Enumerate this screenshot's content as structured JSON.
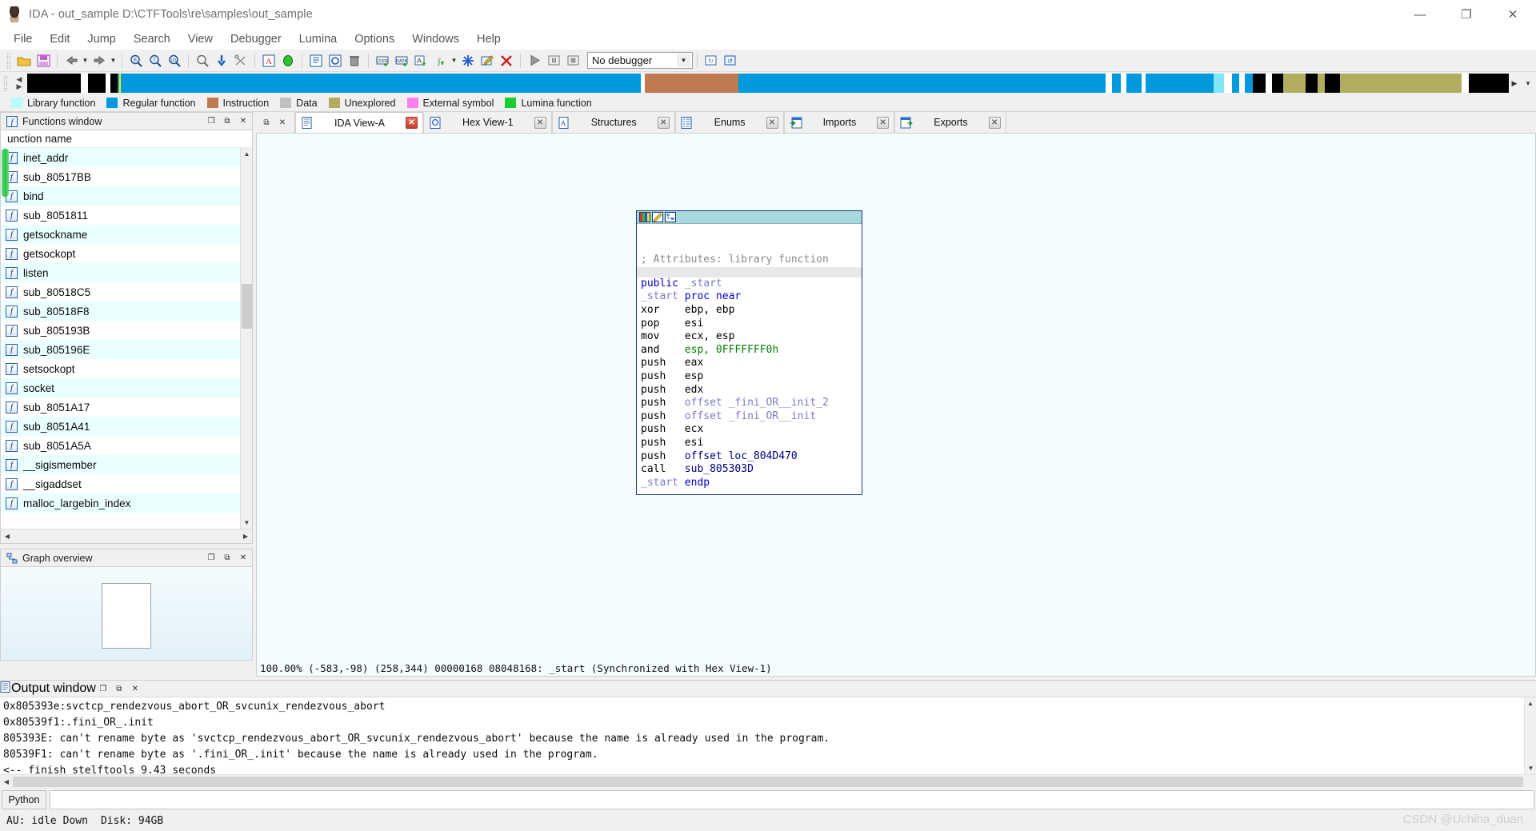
{
  "window": {
    "title": "IDA - out_sample D:\\CTFTools\\re\\samples\\out_sample",
    "app_icon": "ida-logo-icon",
    "minimize": "—",
    "maximize": "❐",
    "close": "✕"
  },
  "menu": {
    "items": [
      {
        "label": "File"
      },
      {
        "label": "Edit"
      },
      {
        "label": "Jump"
      },
      {
        "label": "Search"
      },
      {
        "label": "View"
      },
      {
        "label": "Debugger"
      },
      {
        "label": "Lumina"
      },
      {
        "label": "Options"
      },
      {
        "label": "Windows"
      },
      {
        "label": "Help"
      }
    ]
  },
  "toolbar": {
    "debugger_select_value": "No debugger",
    "buttons": [
      {
        "name": "open-file-icon",
        "glyph": "📂"
      },
      {
        "name": "save-file-icon",
        "glyph": "💾"
      },
      {
        "name": "back-icon",
        "glyph": "⇦"
      },
      {
        "name": "forward-icon",
        "glyph": "⇨"
      },
      {
        "name": "search-hex-icon",
        "glyph": "🔍"
      },
      {
        "name": "search-text-icon",
        "glyph": "🔍"
      },
      {
        "name": "search-imm-icon",
        "glyph": "🔍"
      },
      {
        "name": "search-next-icon",
        "glyph": "🔎"
      },
      {
        "name": "jump-down-icon",
        "glyph": "⬇"
      },
      {
        "name": "cross-ref-icon",
        "glyph": "✂"
      },
      {
        "name": "ida-view-icon",
        "glyph": "A"
      },
      {
        "name": "graph-view-icon",
        "glyph": "⬭"
      },
      {
        "name": "hex-view-icon",
        "glyph": "▤"
      },
      {
        "name": "structures-icon",
        "glyph": "▣"
      },
      {
        "name": "delete-icon",
        "glyph": "🗑"
      },
      {
        "name": "code-icon",
        "glyph": "⌨"
      },
      {
        "name": "data-icon",
        "glyph": "▦"
      },
      {
        "name": "ascii-icon",
        "glyph": "Ⓐ"
      },
      {
        "name": "struct-var-icon",
        "glyph": "ʃ"
      },
      {
        "name": "struct-dropdown-icon",
        "glyph": "▾"
      },
      {
        "name": "undefine-icon",
        "glyph": "✳"
      },
      {
        "name": "edit-function-icon",
        "glyph": "✎"
      },
      {
        "name": "delete-function-icon",
        "glyph": "✕"
      },
      {
        "name": "run-icon",
        "glyph": "▶"
      },
      {
        "name": "pause-icon",
        "glyph": "▐▌"
      },
      {
        "name": "stop-icon",
        "glyph": "■"
      }
    ],
    "right_buttons": [
      {
        "name": "lumina-pull-icon",
        "glyph": "⬇"
      },
      {
        "name": "lumina-push-icon",
        "glyph": "⬆"
      },
      {
        "name": "options-icon",
        "glyph": "⚙"
      },
      {
        "name": "plugin-a-icon",
        "glyph": "▧"
      },
      {
        "name": "plugin-b-icon",
        "glyph": "▨"
      },
      {
        "name": "plugin-c-icon",
        "glyph": "✄"
      }
    ]
  },
  "navigator": {
    "cursor_left_pct": 6.2,
    "segments": [
      {
        "color": "#000000",
        "start_pct": 0.0,
        "width_pct": 3.6
      },
      {
        "color": "#ffffff",
        "start_pct": 3.6,
        "width_pct": 0.5
      },
      {
        "color": "#000000",
        "start_pct": 4.1,
        "width_pct": 1.2
      },
      {
        "color": "#ffffff",
        "start_pct": 5.3,
        "width_pct": 0.3
      },
      {
        "color": "#000000",
        "start_pct": 5.6,
        "width_pct": 0.5
      },
      {
        "color": "#0099dd",
        "start_pct": 6.1,
        "width_pct": 35.3
      },
      {
        "color": "#ffffff",
        "start_pct": 41.4,
        "width_pct": 0.3
      },
      {
        "color": "#c07a52",
        "start_pct": 41.7,
        "width_pct": 6.3
      },
      {
        "color": "#0099dd",
        "start_pct": 48.0,
        "width_pct": 24.8
      },
      {
        "color": "#ffffff",
        "start_pct": 72.8,
        "width_pct": 0.4
      },
      {
        "color": "#0099dd",
        "start_pct": 73.2,
        "width_pct": 0.6
      },
      {
        "color": "#ffffff",
        "start_pct": 73.8,
        "width_pct": 0.4
      },
      {
        "color": "#0099dd",
        "start_pct": 74.2,
        "width_pct": 1.0
      },
      {
        "color": "#ffffff",
        "start_pct": 75.2,
        "width_pct": 0.3
      },
      {
        "color": "#0099dd",
        "start_pct": 75.5,
        "width_pct": 4.6
      },
      {
        "color": "#7fe8f5",
        "start_pct": 80.1,
        "width_pct": 0.7
      },
      {
        "color": "#ffffff",
        "start_pct": 80.8,
        "width_pct": 0.5
      },
      {
        "color": "#0099dd",
        "start_pct": 81.3,
        "width_pct": 0.5
      },
      {
        "color": "#ffffff",
        "start_pct": 81.8,
        "width_pct": 0.4
      },
      {
        "color": "#0099dd",
        "start_pct": 82.2,
        "width_pct": 0.5
      },
      {
        "color": "#000000",
        "start_pct": 82.7,
        "width_pct": 0.9
      },
      {
        "color": "#ffffff",
        "start_pct": 83.6,
        "width_pct": 0.4
      },
      {
        "color": "#000000",
        "start_pct": 84.0,
        "width_pct": 0.8
      },
      {
        "color": "#b0ae5e",
        "start_pct": 84.8,
        "width_pct": 1.5
      },
      {
        "color": "#000000",
        "start_pct": 86.3,
        "width_pct": 0.8
      },
      {
        "color": "#b0ae5e",
        "start_pct": 87.1,
        "width_pct": 0.5
      },
      {
        "color": "#000000",
        "start_pct": 87.6,
        "width_pct": 1.0
      },
      {
        "color": "#b0ae5e",
        "start_pct": 88.6,
        "width_pct": 8.2
      },
      {
        "color": "#ffffff",
        "start_pct": 96.8,
        "width_pct": 0.5
      },
      {
        "color": "#000000",
        "start_pct": 97.3,
        "width_pct": 2.7
      }
    ]
  },
  "legend": {
    "items": [
      {
        "label": "Library function",
        "color": "#b6fcf9"
      },
      {
        "label": "Regular function",
        "color": "#0099dd"
      },
      {
        "label": "Instruction",
        "color": "#c07a52"
      },
      {
        "label": "Data",
        "color": "#c0c0c0"
      },
      {
        "label": "Unexplored",
        "color": "#b0ae5e"
      },
      {
        "label": "External symbol",
        "color": "#ff7ff0"
      },
      {
        "label": "Lumina function",
        "color": "#19cc2f"
      }
    ]
  },
  "functions_window": {
    "title": "Functions window",
    "icon": "function-window-icon",
    "column_header": "unction name",
    "restore_btn": "❐",
    "float_btn": "⧉",
    "close_btn": "✕",
    "rows": [
      {
        "name": "inet_addr"
      },
      {
        "name": "sub_80517BB"
      },
      {
        "name": "bind"
      },
      {
        "name": "sub_8051811"
      },
      {
        "name": "getsockname"
      },
      {
        "name": "getsockopt"
      },
      {
        "name": "listen"
      },
      {
        "name": "sub_80518C5"
      },
      {
        "name": "sub_80518F8"
      },
      {
        "name": "sub_805193B"
      },
      {
        "name": "sub_805196E"
      },
      {
        "name": "setsockopt"
      },
      {
        "name": "socket"
      },
      {
        "name": "sub_8051A17"
      },
      {
        "name": "sub_8051A41"
      },
      {
        "name": "sub_8051A5A"
      },
      {
        "name": "__sigismember"
      },
      {
        "name": "__sigaddset"
      },
      {
        "name": "malloc_largebin_index"
      }
    ]
  },
  "graph_overview": {
    "title": "Graph overview",
    "icon": "graph-overview-icon",
    "restore_btn": "❐",
    "float_btn": "⧉",
    "close_btn": "✕"
  },
  "tabs": {
    "items": [
      {
        "label": "IDA View-A",
        "icon": "ida-view-tab-icon",
        "active": true,
        "close": "✕"
      },
      {
        "label": "Hex View-1",
        "icon": "hex-view-tab-icon",
        "active": false,
        "close": "✕"
      },
      {
        "label": "Structures",
        "icon": "structures-tab-icon",
        "active": false,
        "close": "✕"
      },
      {
        "label": "Enums",
        "icon": "enums-tab-icon",
        "active": false,
        "close": "✕"
      },
      {
        "label": "Imports",
        "icon": "imports-tab-icon",
        "active": false,
        "close": "✕"
      },
      {
        "label": "Exports",
        "icon": "exports-tab-icon",
        "active": false,
        "close": "✕"
      }
    ],
    "dock_restore": "⧉",
    "dock_close": "✕"
  },
  "graph_node": {
    "titlebar_buttons": [
      {
        "name": "node-color-icon"
      },
      {
        "name": "node-edit-icon"
      },
      {
        "name": "node-layout-icon"
      }
    ],
    "lines": [
      {
        "type": "blank"
      },
      {
        "type": "blank"
      },
      {
        "type": "comment",
        "text": "; Attributes: library function"
      },
      {
        "type": "separator"
      },
      {
        "type": "code",
        "mnemonic": "public",
        "operands": "_start",
        "mn_class": "c-kw",
        "op_class": "c-name"
      },
      {
        "type": "code",
        "mnemonic": "_start",
        "operands": "proc near",
        "mn_class": "c-name",
        "op_class": "c-kw"
      },
      {
        "type": "code",
        "mnemonic": "xor",
        "operands": "ebp, ebp",
        "mn_class": "c-reg",
        "op_class": "c-reg"
      },
      {
        "type": "code",
        "mnemonic": "pop",
        "operands": "esi",
        "mn_class": "c-reg",
        "op_class": "c-reg"
      },
      {
        "type": "code",
        "mnemonic": "mov",
        "operands": "ecx, esp",
        "mn_class": "c-reg",
        "op_class": "c-reg"
      },
      {
        "type": "code",
        "mnemonic": "and",
        "operands": "esp, 0FFFFFFF0h",
        "mn_class": "c-reg",
        "op_class": "c-num"
      },
      {
        "type": "code",
        "mnemonic": "push",
        "operands": "eax",
        "mn_class": "c-reg",
        "op_class": "c-reg"
      },
      {
        "type": "code",
        "mnemonic": "push",
        "operands": "esp",
        "mn_class": "c-reg",
        "op_class": "c-reg"
      },
      {
        "type": "code",
        "mnemonic": "push",
        "operands": "edx",
        "mn_class": "c-reg",
        "op_class": "c-reg"
      },
      {
        "type": "code",
        "mnemonic": "push",
        "operands": "offset _fini_OR__init_2",
        "mn_class": "c-reg",
        "op_class": "c-name"
      },
      {
        "type": "code",
        "mnemonic": "push",
        "operands": "offset _fini_OR__init",
        "mn_class": "c-reg",
        "op_class": "c-name"
      },
      {
        "type": "code",
        "mnemonic": "push",
        "operands": "ecx",
        "mn_class": "c-reg",
        "op_class": "c-reg"
      },
      {
        "type": "code",
        "mnemonic": "push",
        "operands": "esi",
        "mn_class": "c-reg",
        "op_class": "c-reg"
      },
      {
        "type": "code",
        "mnemonic": "push",
        "operands": "offset loc_804D470",
        "mn_class": "c-reg",
        "op_class": "c-loc"
      },
      {
        "type": "code",
        "mnemonic": "call",
        "operands": "sub_805303D",
        "mn_class": "c-reg",
        "op_class": "c-loc"
      },
      {
        "type": "code",
        "mnemonic": "_start",
        "operands": "endp",
        "mn_class": "c-name",
        "op_class": "c-kw"
      }
    ]
  },
  "view_status": {
    "zoom": "100.00%",
    "graph_coords": "(-583,-98)",
    "mouse_coords": "(258,344)",
    "file_offset": "00000168",
    "address": "08048168:",
    "symbol": "_start",
    "sync": "(Synchronized with Hex View-1)",
    "full": "100.00%  (-583,-98) (258,344) 00000168 08048168: _start (Synchronized with Hex View-1)"
  },
  "output_window": {
    "title": "Output window",
    "icon": "output-window-icon",
    "restore_btn": "❐",
    "float_btn": "⧉",
    "close_btn": "✕",
    "lines": [
      "0x805393e:svctcp_rendezvous_abort_OR_svcunix_rendezvous_abort",
      "0x80539f1:.fini_OR_.init",
      "805393E: can't rename byte as 'svctcp_rendezvous_abort_OR_svcunix_rendezvous_abort' because the name is already used in the program.",
      "80539F1: can't rename byte as '.fini_OR_.init' because the name is already used in the program.",
      "<-- finish stelftools 9.43 seconds"
    ]
  },
  "python_bar": {
    "button_label": "Python",
    "input_value": "",
    "input_placeholder": ""
  },
  "status_bar": {
    "au": "AU: idle",
    "down": "Down",
    "disk": "Disk: 94GB",
    "watermark": "CSDN @Uchiha_duan"
  }
}
